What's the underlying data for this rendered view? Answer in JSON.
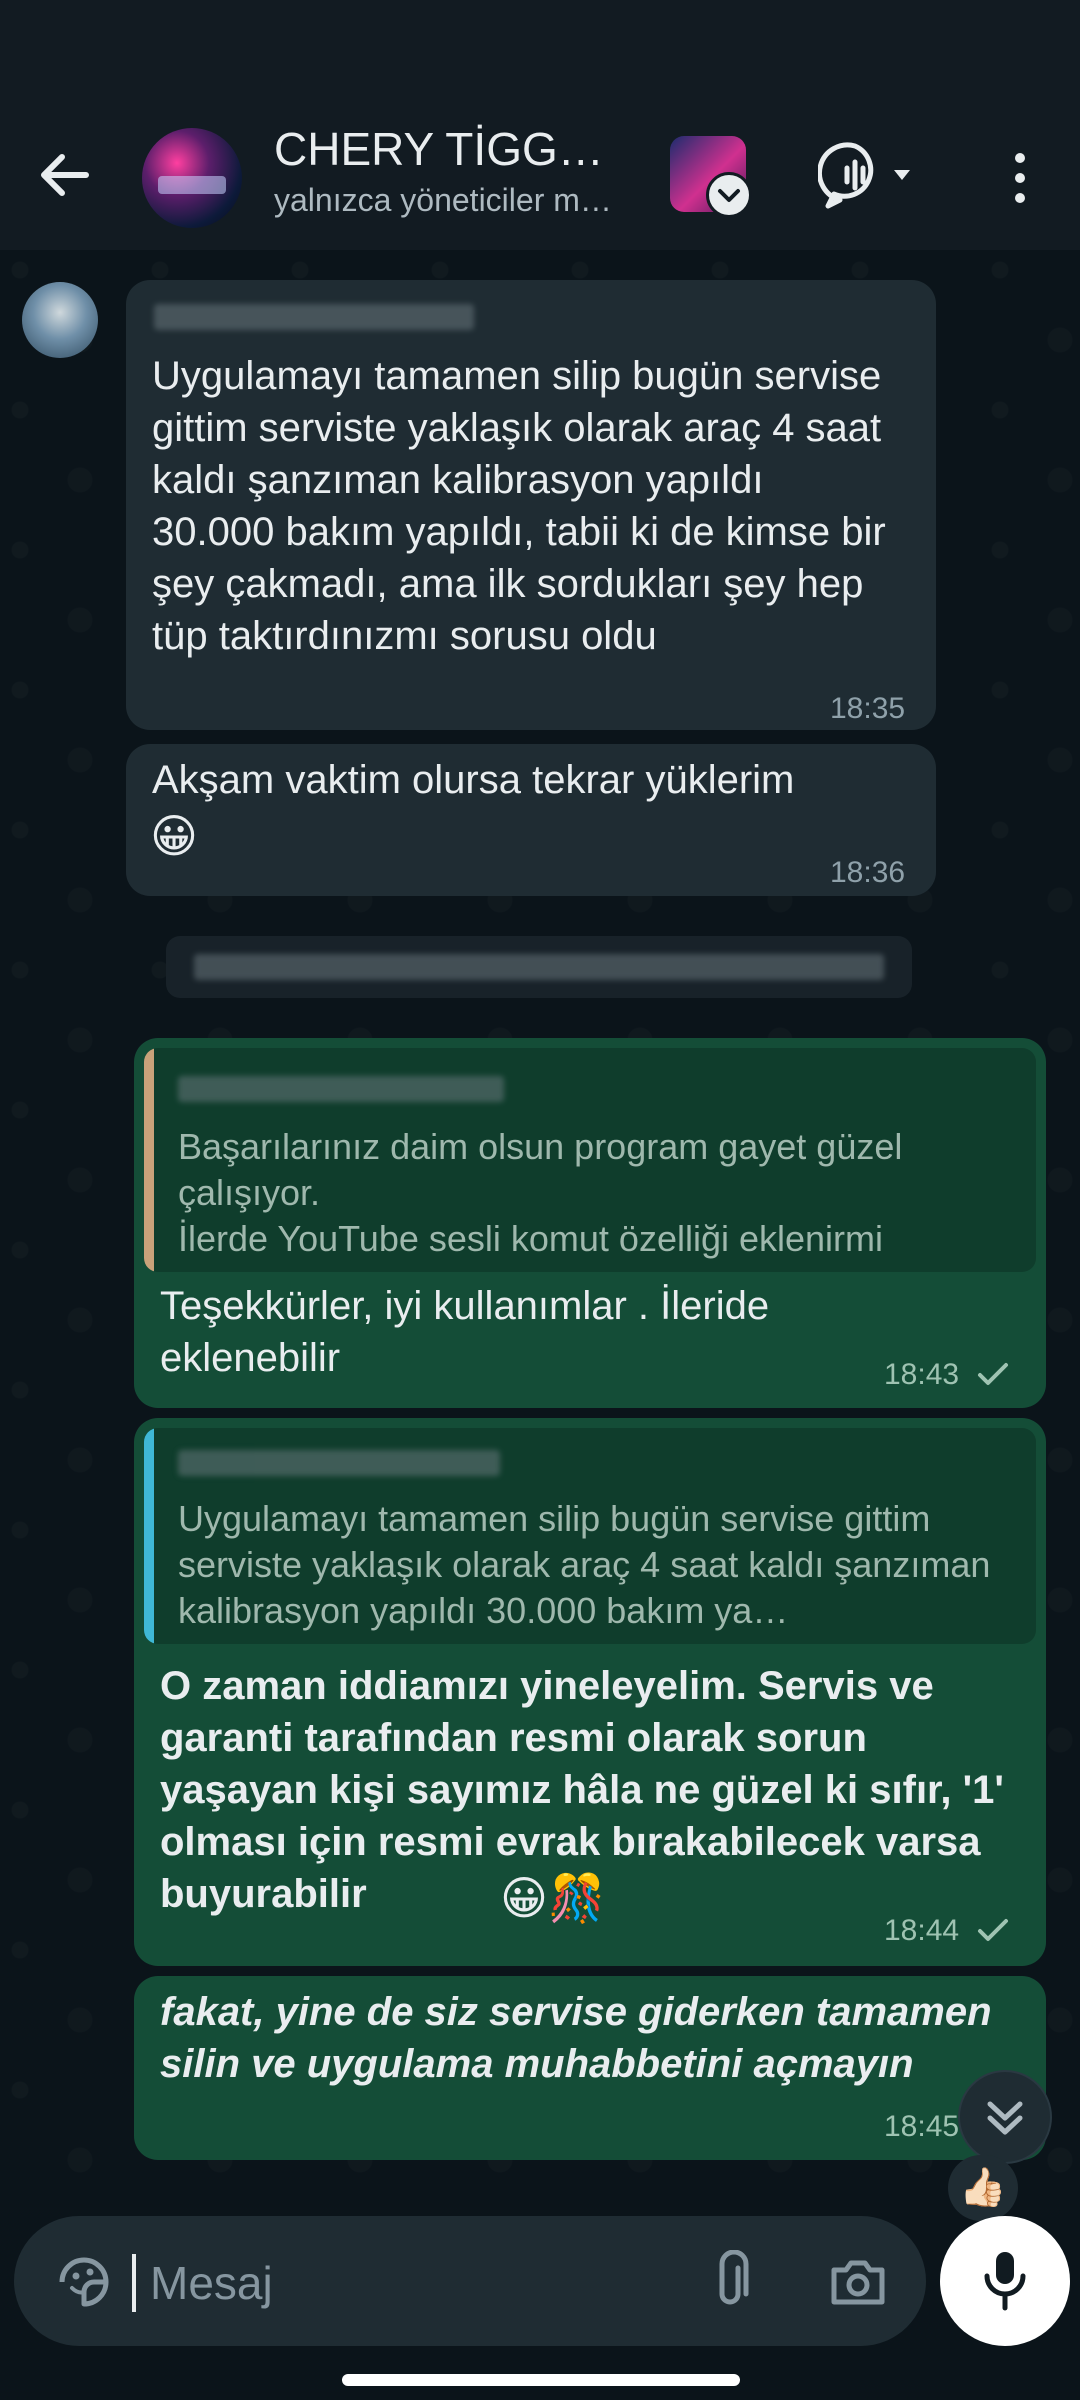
{
  "header": {
    "title": "CHERY TİGGO…",
    "subtitle": "yalnızca yöneticiler m…"
  },
  "messages": [
    {
      "text": "Uygulamayı tamamen silip bugün servise gittim serviste yaklaşık olarak araç 4 saat kaldı şanzıman kalibrasyon yapıldı 30.000 bakım yapıldı, tabii ki de kimse bir şey çakmadı, ama ilk sordukları şey hep tüp taktırdınızmı sorusu oldu",
      "time": "18:35"
    },
    {
      "text": "Akşam vaktim olursa tekrar yüklerim",
      "emoji": "😀",
      "time": "18:36"
    },
    {
      "quote": "Başarılarınız daim olsun program gayet güzel çalışıyor.\nİlerde YouTube sesli komut özelliği eklenirmi",
      "text": "Teşekkürler, iyi kullanımlar . İleride eklenebilir",
      "time": "18:43"
    },
    {
      "quote": "Uygulamayı tamamen silip bugün servise gittim serviste yaklaşık olarak araç 4 saat kaldı şanzıman kalibrasyon yapıldı 30.000 bakım ya…",
      "text": "O zaman iddiamızı yineleyelim. Servis ve garanti tarafından resmi olarak sorun yaşayan kişi sayımız hâla ne güzel ki sıfır, '1' olması için resmi evrak bırakabilecek varsa buyurabilir",
      "emoji": "😀🎊",
      "time": "18:44"
    },
    {
      "text": "fakat, yine de siz servise giderken tamamen silin ve uygulama muhabbetini açmayın",
      "time": "18:45"
    }
  ],
  "reaction": "👍🏻",
  "composer": {
    "placeholder": "Mesaj"
  },
  "colors": {
    "background": "#0b141a",
    "incoming_bubble": "#1f2c33",
    "outgoing_bubble": "#144d37",
    "quote_bar_1": "#c9a27a",
    "quote_bar_2": "#3fb8d6"
  },
  "icons": [
    "back-arrow-icon",
    "group-avatar",
    "voice-chat-icon",
    "more-options-icon",
    "tick-icon",
    "scroll-down-icon",
    "sticker-icon",
    "attach-icon",
    "camera-icon",
    "mic-icon"
  ]
}
